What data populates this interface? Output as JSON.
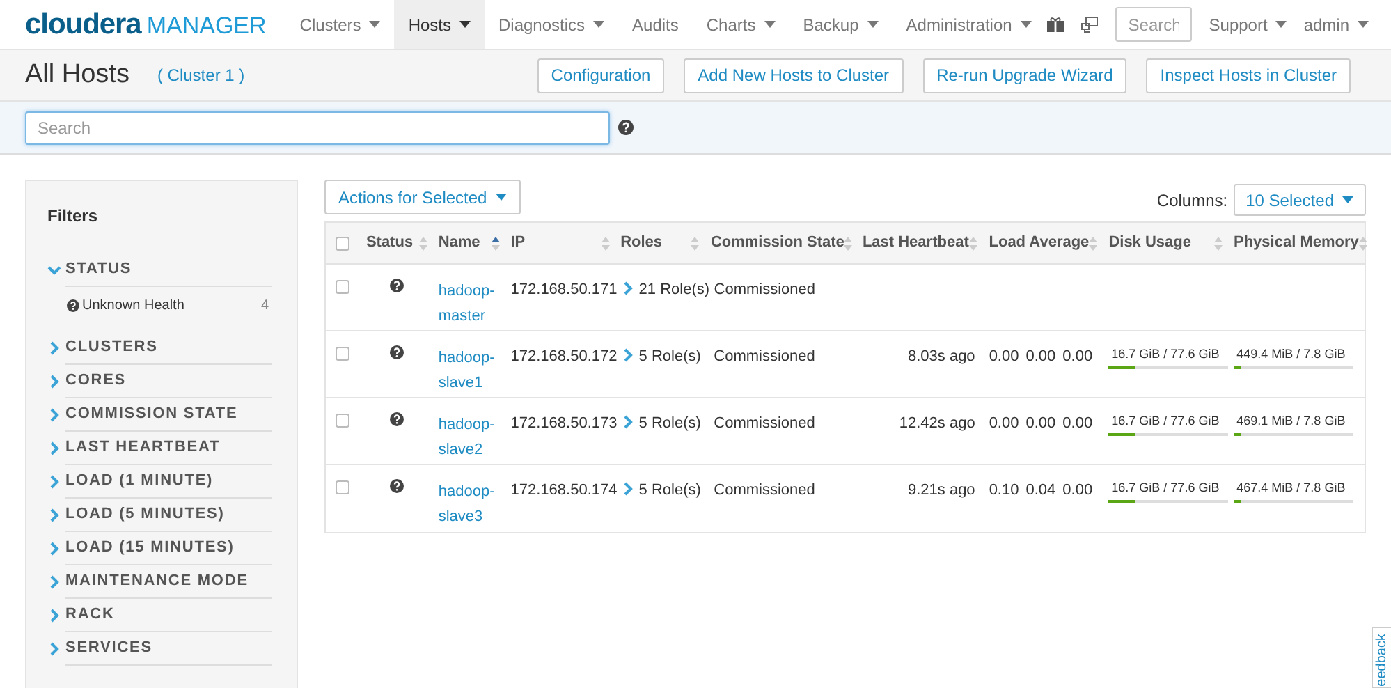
{
  "nav": {
    "logo_brand": "cloudera",
    "logo_product": "MANAGER",
    "items": [
      {
        "label": "Clusters",
        "selected": false
      },
      {
        "label": "Hosts",
        "selected": true
      },
      {
        "label": "Diagnostics",
        "selected": false
      },
      {
        "label": "Audits",
        "selected": false,
        "kind": "link"
      },
      {
        "label": "Charts",
        "selected": false
      },
      {
        "label": "Backup",
        "selected": false
      },
      {
        "label": "Administration",
        "selected": false
      }
    ],
    "search_placeholder": "Search",
    "right_items": [
      "Support",
      "admin"
    ]
  },
  "header": {
    "title": "All Hosts",
    "cluster": "( Cluster 1 )",
    "buttons": [
      "Configuration",
      "Add New Hosts to Cluster",
      "Re-run Upgrade Wizard",
      "Inspect Hosts in Cluster"
    ]
  },
  "search": {
    "placeholder": "Search"
  },
  "filters": {
    "title": "Filters",
    "groups": [
      {
        "label": "STATUS",
        "expanded": true,
        "children": [
          {
            "label": "Unknown Health",
            "count": "4"
          }
        ]
      },
      {
        "label": "CLUSTERS",
        "expanded": false
      },
      {
        "label": "CORES",
        "expanded": false
      },
      {
        "label": "COMMISSION STATE",
        "expanded": false
      },
      {
        "label": "LAST HEARTBEAT",
        "expanded": false
      },
      {
        "label": "LOAD (1 MINUTE)",
        "expanded": false
      },
      {
        "label": "LOAD (5 MINUTES)",
        "expanded": false
      },
      {
        "label": "LOAD (15 MINUTES)",
        "expanded": false
      },
      {
        "label": "MAINTENANCE MODE",
        "expanded": false
      },
      {
        "label": "RACK",
        "expanded": false
      },
      {
        "label": "SERVICES",
        "expanded": false
      }
    ]
  },
  "actions_button": "Actions for Selected",
  "columns_label": "Columns:",
  "columns_button": "10 Selected",
  "table": {
    "select_all_checked": false,
    "columns": [
      {
        "label": "Status",
        "sorted": false
      },
      {
        "label": "Name",
        "sorted": true
      },
      {
        "label": "IP",
        "sorted": false
      },
      {
        "label": "Roles",
        "sorted": false
      },
      {
        "label": "Commission State",
        "sorted": false
      },
      {
        "label": "Last Heartbeat",
        "sorted": false
      },
      {
        "label": "Load Average",
        "sorted": false
      },
      {
        "label": "Disk Usage",
        "sorted": false
      },
      {
        "label": "Physical Memory",
        "sorted": false
      }
    ],
    "rows": [
      {
        "checked": false,
        "name": "hadoop-master",
        "ip": "172.168.50.171",
        "roles": "21 Role(s)",
        "commission": "Commissioned"
      },
      {
        "checked": false,
        "name": "hadoop-slave1",
        "ip": "172.168.50.172",
        "roles": "5 Role(s)",
        "commission": "Commissioned",
        "heartbeat": "8.03s ago",
        "load": [
          "0.00",
          "0.00",
          "0.00"
        ],
        "disk": {
          "text": "16.7 GiB / 77.6 GiB",
          "level": 0.22
        },
        "memory": {
          "text": "449.4 MiB / 7.8 GiB",
          "level": 0.06
        }
      },
      {
        "checked": false,
        "name": "hadoop-slave2",
        "ip": "172.168.50.173",
        "roles": "5 Role(s)",
        "commission": "Commissioned",
        "heartbeat": "12.42s ago",
        "load": [
          "0.00",
          "0.00",
          "0.00"
        ],
        "disk": {
          "text": "16.7 GiB / 77.6 GiB",
          "level": 0.22
        },
        "memory": {
          "text": "469.1 MiB / 7.8 GiB",
          "level": 0.06
        }
      },
      {
        "checked": false,
        "name": "hadoop-slave3",
        "ip": "172.168.50.174",
        "roles": "5 Role(s)",
        "commission": "Commissioned",
        "heartbeat": "9.21s ago",
        "load": [
          "0.10",
          "0.04",
          "0.00"
        ],
        "disk": {
          "text": "16.7 GiB / 77.6 GiB",
          "level": 0.22
        },
        "memory": {
          "text": "467.4 MiB / 7.8 GiB",
          "level": 0.06
        }
      }
    ]
  },
  "feedback_tab": "eedback"
}
